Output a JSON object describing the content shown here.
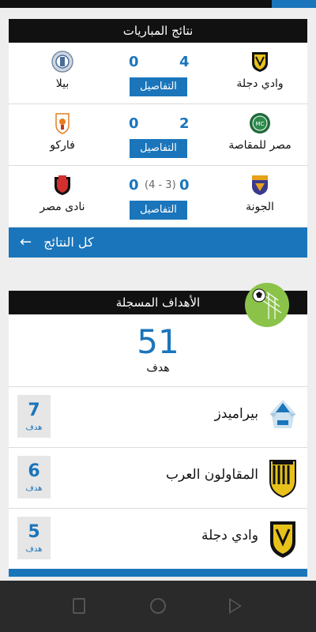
{
  "results": {
    "header": "نتائج المباريات",
    "matches": [
      {
        "home": "وادي دجلة",
        "away": "بيلا",
        "home_score": "4",
        "away_score": "0",
        "penalties": "",
        "details": "التفاصيل"
      },
      {
        "home": "مصر للمقاصة",
        "away": "فاركو",
        "home_score": "2",
        "away_score": "0",
        "penalties": "",
        "details": "التفاصيل"
      },
      {
        "home": "الجونة",
        "away": "نادى مصر",
        "home_score": "0",
        "away_score": "0",
        "penalties": "(4 - 3)",
        "details": "التفاصيل"
      }
    ],
    "all_results": "كل النتائج"
  },
  "goals": {
    "header": "الأهداف المسجلة",
    "total": "51",
    "total_label": "هدف",
    "scorers": [
      {
        "team": "بيراميدز",
        "goals": "7",
        "unit": "هدف"
      },
      {
        "team": "المقاولون العرب",
        "goals": "6",
        "unit": "هدف"
      },
      {
        "team": "وادي دجلة",
        "goals": "5",
        "unit": "هدف"
      }
    ]
  },
  "colors": {
    "accent": "#1a75bb",
    "header": "#111111",
    "background": "#eeeeee"
  }
}
